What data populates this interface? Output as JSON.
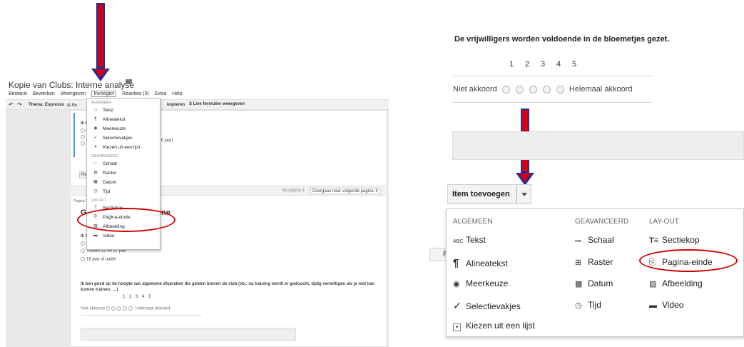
{
  "left": {
    "doc_title": "Kopie van Clubs: Interne analyse",
    "menubar": [
      "Bestand",
      "Bewerken",
      "Weergeven",
      "Invoegen",
      "Reacties (0)",
      "Extra",
      "Help"
    ],
    "toolbar": {
      "theme": "Thema: Espresso",
      "re": "Re",
      "kopieren": "kopieren",
      "live": "Live formulier weergeven"
    },
    "dropdown": {
      "sec_algemeen": "ALGEMEEN",
      "sec_geavanceerd": "GEAVANCEERD",
      "sec_layout": "LAY-OUT",
      "items": {
        "tekst": "Tekst",
        "alineatekst": "Alineatekst",
        "meerkeuze": "Meerkeuze",
        "selectievakjes": "Selectievakjes",
        "kiezen": "Kiezen uit een lijst",
        "schaal": "Schaal",
        "raster": "Raster",
        "datum": "Datum",
        "tijd": "Tijd",
        "sectiekop": "Sectiekop",
        "pagina_einde": "Pagina-einde",
        "afbeelding": "Afbeelding",
        "video": "Video"
      }
    },
    "bg": {
      "ik1": "Ik b",
      "jaar": "lt jaar)",
      "ner": "Ner",
      "na_pagina": "Na pagina 1",
      "doorgaan": "Doorgaan naar volgende pagina",
      "pagina2": "Pagina 2",
      "g": "G",
      "ine": "ine",
      "ik2": "Ik b",
      "opt1": "Tussen 12 en 17 jaar",
      "opt2": "18 jaar of ouder",
      "question": "Ik ben goed op de hoogte van algemene afspraken die gelden binnen de club (vb.: na training wordt er gedoucht, tijdig verwittigen als je niet kan komen trainen, …)",
      "scale": [
        "1",
        "2",
        "3",
        "4",
        "5"
      ],
      "low": "Niet akkoord",
      "high": "Helemaal akkoord"
    }
  },
  "right": {
    "question": "De vrijwilligers worden voldoende in de bloemetjes gezet.",
    "scale": [
      "1",
      "2",
      "3",
      "4",
      "5"
    ],
    "low": "Niet akkoord",
    "high": "Helemaal akkoord",
    "item_button": "Item toevoegen",
    "pag": "Pag",
    "menu": {
      "col1": "ALGEMEEN",
      "col2": "GEAVANCEERD",
      "col3": "LAY-OUT",
      "tekst": "Tekst",
      "alineatekst": "Alineatekst",
      "meerkeuze": "Meerkeuze",
      "selectievakjes": "Selectievakjes",
      "kiezen": "Kiezen uit een lijst",
      "schaal": "Schaal",
      "raster": "Raster",
      "datum": "Datum",
      "tijd": "Tijd",
      "sectiekop": "Sectiekop",
      "pagina_einde": "Pagina-einde",
      "afbeelding": "Afbeelding",
      "video": "Video",
      "abc": "ABC"
    }
  },
  "colors": {
    "arrow_fill": "#d10010",
    "arrow_border": "#1f2fa0",
    "highlight_ellipse": "#d40000"
  }
}
